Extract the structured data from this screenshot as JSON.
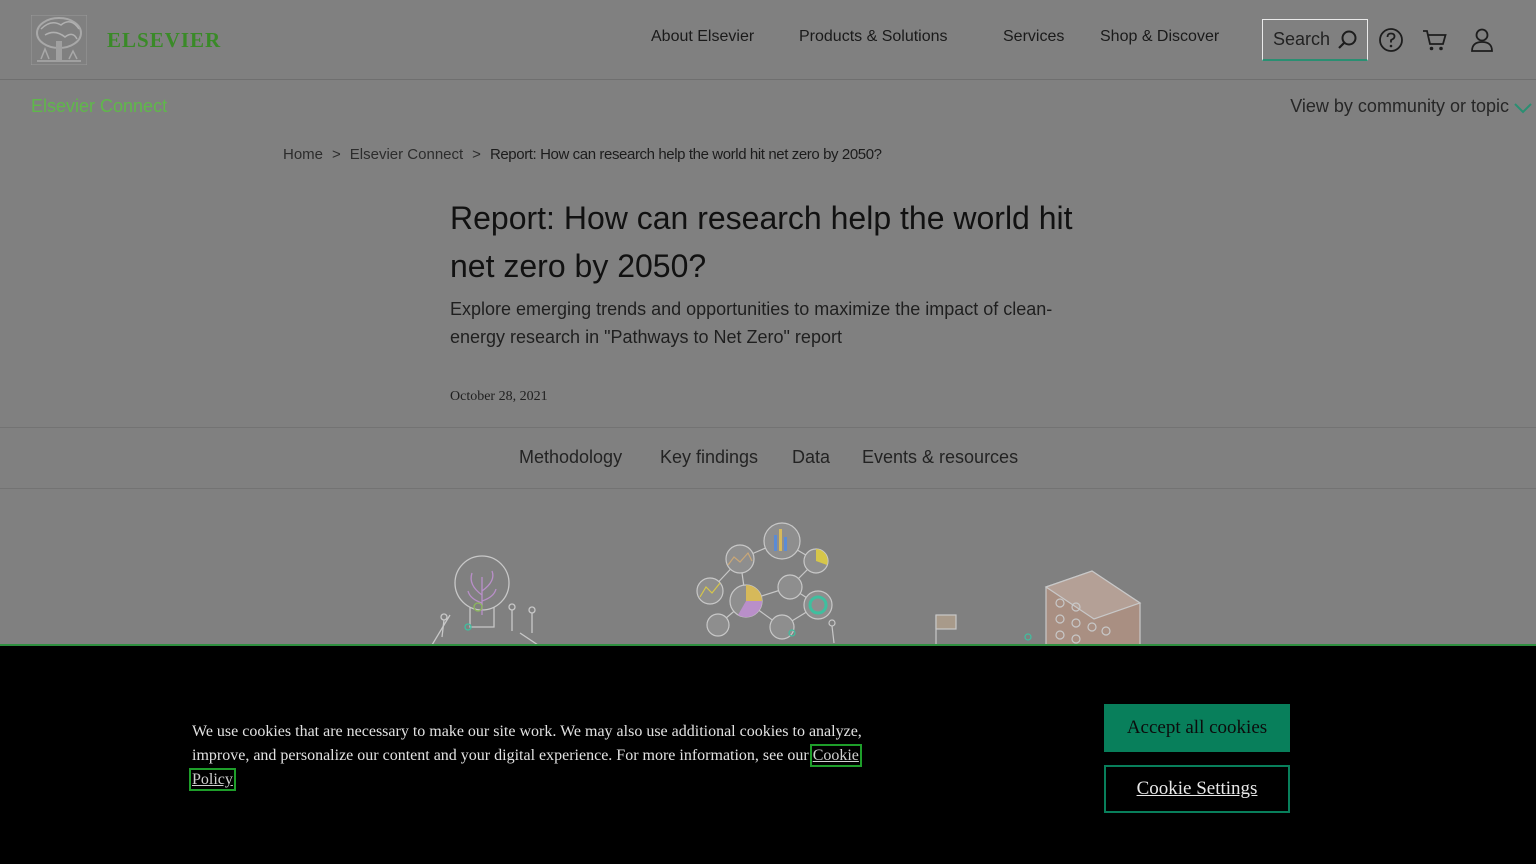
{
  "header": {
    "logo_text": "ELSEVIER",
    "nav": [
      "About Elsevier",
      "Products & Solutions",
      "Services",
      "Shop & Discover"
    ],
    "search_label": "Search"
  },
  "subnav": {
    "connect_label": "Elsevier Connect",
    "view_by_label": "View by community or topic"
  },
  "breadcrumb": {
    "home": "Home",
    "section": "Elsevier Connect",
    "current": "Report: How can research help the world hit net zero by 2050?"
  },
  "article": {
    "title": "Report: How can research help the world hit net zero by 2050?",
    "subtitle": "Explore emerging trends and opportunities to maximize the impact of clean-energy research in \"Pathways to Net Zero\" report",
    "date": "October 28, 2021"
  },
  "tabs": [
    "Methodology",
    "Key findings",
    "Data",
    "Events & resources"
  ],
  "cookie": {
    "text": "We use cookies that are necessary to make our site work. We may also use additional cookies to analyze, improve, and personalize our content and your digital experience. For more information, see our",
    "link_label": "Cookie Policy",
    "accept_label": "Accept all cookies",
    "settings_label": "Cookie Settings"
  },
  "colors": {
    "brand_green": "#3a8a28",
    "accent_teal": "#087f5b",
    "page_bg": "#808080"
  },
  "icons": [
    "elsevier-tree-logo",
    "search-icon",
    "help-icon",
    "cart-icon",
    "user-icon",
    "chevron-down-icon"
  ]
}
